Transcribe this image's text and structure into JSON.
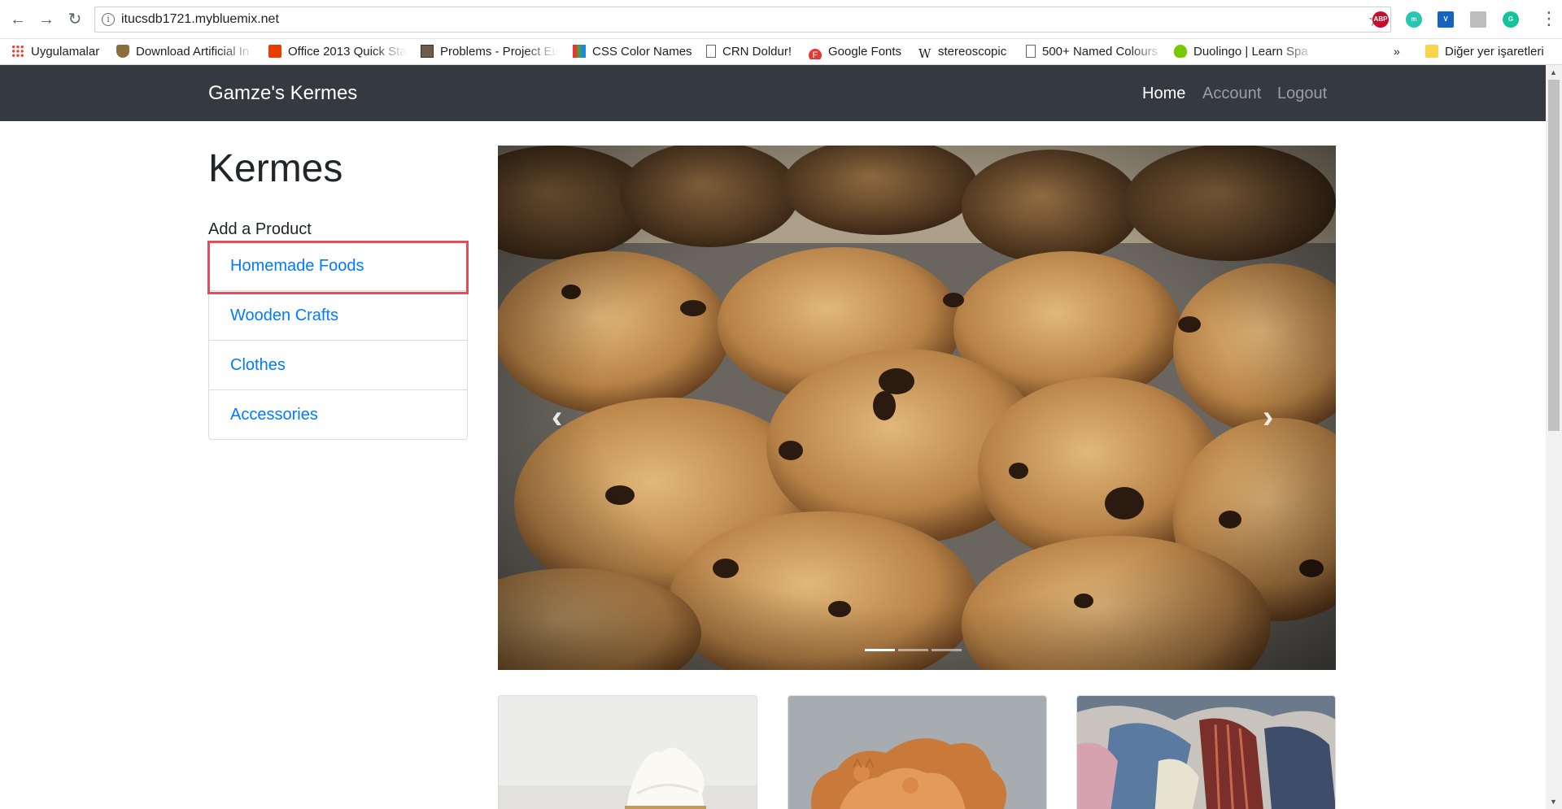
{
  "browser": {
    "url": "itucsdb1721.mybluemix.net",
    "bookmarks": [
      {
        "label": "Uygulamalar",
        "icon": "apps-grid-icon"
      },
      {
        "label": "Download Artificial In",
        "icon": "shield-icon"
      },
      {
        "label": "Office 2013 Quick Sta",
        "icon": "office-icon"
      },
      {
        "label": "Problems - Project Eu",
        "icon": "project-euler-icon"
      },
      {
        "label": "CSS Color Names",
        "icon": "color-grid-icon"
      },
      {
        "label": "CRN Doldur!",
        "icon": "page-icon"
      },
      {
        "label": "Google Fonts",
        "icon": "google-fonts-icon"
      },
      {
        "label": "stereoscopic",
        "icon": "wikipedia-icon"
      },
      {
        "label": "500+ Named Colours",
        "icon": "page-icon"
      },
      {
        "label": "Duolingo | Learn Spa",
        "icon": "duolingo-icon"
      }
    ],
    "more_bookmarks": "»",
    "other_bookmarks": "Diğer yer işaretleri",
    "extensions": [
      {
        "name": "abp-icon",
        "label": "ABP",
        "color": "#c70d2c"
      },
      {
        "name": "m-extension-icon",
        "label": "m",
        "color": "#26c6b0"
      },
      {
        "name": "v-extension-icon",
        "label": "V",
        "color": "#1565c0"
      },
      {
        "name": "drive-icon",
        "label": "",
        "color": "#bdbdbd"
      },
      {
        "name": "grammarly-icon",
        "label": "G",
        "color": "#15c39a"
      }
    ]
  },
  "navbar": {
    "brand": "Gamze's Kermes",
    "links": [
      "Home",
      "Account",
      "Logout"
    ],
    "active": "Home"
  },
  "main": {
    "heading": "Kermes",
    "add_label": "Add a Product",
    "categories": [
      "Homemade Foods",
      "Wooden Crafts",
      "Clothes",
      "Accessories"
    ],
    "highlighted_category": "Homemade Foods"
  },
  "carousel": {
    "slides": 3,
    "active_slide": 1,
    "prev_glyph": "‹",
    "next_glyph": "›"
  },
  "colors": {
    "navbar_bg": "#343a40",
    "link": "#007bff",
    "highlight": "#e74c5a"
  }
}
